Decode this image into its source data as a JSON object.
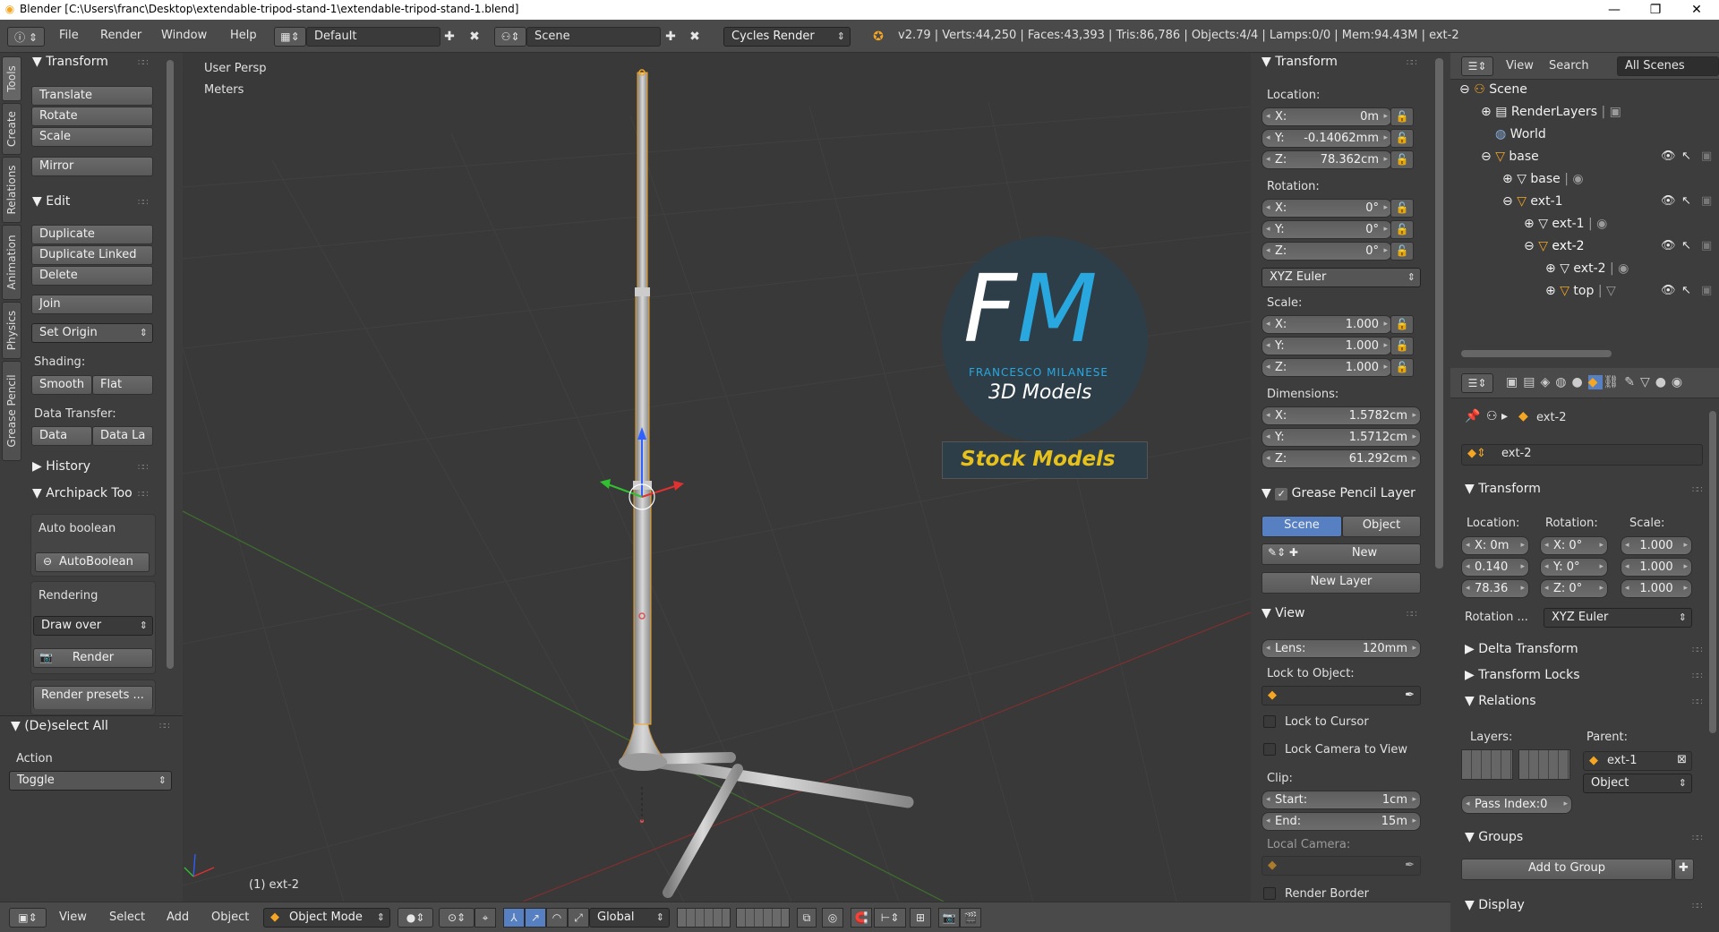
{
  "window": {
    "title": "Blender [C:\\Users\\franc\\Desktop\\extendable-tripod-stand-1\\extendable-tripod-stand-1.blend]",
    "minimize": "—",
    "maximize": "❐",
    "close": "✕"
  },
  "menubar": {
    "items": [
      "File",
      "Render",
      "Window",
      "Help"
    ],
    "layout": "Default",
    "scene": "Scene",
    "engine": "Cycles Render",
    "stats": "v2.79 | Verts:44,250 | Faces:43,393 | Tris:86,786 | Objects:4/4 | Lamps:0/0 | Mem:94.43M | ext-2"
  },
  "tabs": [
    "Tools",
    "Create",
    "Relations",
    "Animation",
    "Physics",
    "Grease Pencil"
  ],
  "toolshelf": {
    "transform_header": "Transform",
    "translate": "Translate",
    "rotate": "Rotate",
    "scale": "Scale",
    "mirror": "Mirror",
    "edit_header": "Edit",
    "duplicate": "Duplicate",
    "duplicate_linked": "Duplicate Linked",
    "delete": "Delete",
    "join": "Join",
    "set_origin": "Set Origin",
    "shading_label": "Shading:",
    "smooth": "Smooth",
    "flat": "Flat",
    "data_transfer_label": "Data Transfer:",
    "data": "Data",
    "data_la": "Data La",
    "history_header": "History",
    "archipack_header": "Archipack Too",
    "auto_boolean_label": "Auto boolean",
    "auto_boolean_btn": "AutoBoolean",
    "rendering_label": "Rendering",
    "draw_over": "Draw over",
    "render_btn": "Render",
    "render_presets": "Render presets ..."
  },
  "operator": {
    "header": "(De)select All",
    "action_label": "Action",
    "action_value": "Toggle"
  },
  "viewport": {
    "view_name": "User Persp",
    "units": "Meters",
    "object_label": "(1) ext-2",
    "watermark_initials_f": "F",
    "watermark_initials_m": "M",
    "watermark_name": "FRANCESCO MILANESE",
    "watermark_sub": "3D Models",
    "watermark_stock": "Stock Models"
  },
  "npanel": {
    "transform_header": "Transform",
    "location_label": "Location:",
    "loc_x": "0m",
    "loc_y": "-0.14062mm",
    "loc_z": "78.362cm",
    "rotation_label": "Rotation:",
    "rot_x": "0°",
    "rot_y": "0°",
    "rot_z": "0°",
    "rotation_mode": "XYZ Euler",
    "scale_label": "Scale:",
    "scale_x": "1.000",
    "scale_y": "1.000",
    "scale_z": "1.000",
    "dimensions_label": "Dimensions:",
    "dim_x": "1.5782cm",
    "dim_y": "1.5712cm",
    "dim_z": "61.292cm",
    "gp_header": "Grease Pencil Layer",
    "gp_scene": "Scene",
    "gp_object": "Object",
    "gp_new": "New",
    "gp_new_layer": "New Layer",
    "view_header": "View",
    "lens_label": "Lens:",
    "lens_value": "120mm",
    "lock_to_object": "Lock to Object:",
    "lock_to_cursor": "Lock to Cursor",
    "lock_camera": "Lock Camera to View",
    "clip_label": "Clip:",
    "clip_start_label": "Start:",
    "clip_start": "1cm",
    "clip_end_label": "End:",
    "clip_end": "15m",
    "local_camera": "Local Camera:",
    "render_border": "Render Border"
  },
  "outliner": {
    "view": "View",
    "search": "Search",
    "all_scenes": "All Scenes",
    "items": [
      {
        "label": "Scene"
      },
      {
        "label": "RenderLayers"
      },
      {
        "label": "World"
      },
      {
        "label": "base"
      },
      {
        "label": "base"
      },
      {
        "label": "ext-1"
      },
      {
        "label": "ext-1"
      },
      {
        "label": "ext-2"
      },
      {
        "label": "ext-2"
      },
      {
        "label": "top"
      }
    ]
  },
  "properties": {
    "breadcrumb": "ext-2",
    "object_name": "ext-2",
    "transform_header": "Transform",
    "location_label": "Location:",
    "rotation_label": "Rotation:",
    "scale_label": "Scale:",
    "loc_x": "X: 0m",
    "loc_y": "0.140",
    "loc_z": "78.36",
    "rot_x": "X:  0°",
    "rot_y": "Y:  0°",
    "rot_z": "Z:  0°",
    "sc_x": "1.000",
    "sc_y": "1.000",
    "sc_z": "1.000",
    "rotation_mode_label": "Rotation ...",
    "rotation_mode": "XYZ Euler",
    "delta_header": "Delta Transform",
    "locks_header": "Transform Locks",
    "relations_header": "Relations",
    "layers_label": "Layers:",
    "parent_label": "Parent:",
    "parent_value": "ext-1",
    "parent_type": "Object",
    "pass_index": "Pass Index:0",
    "groups_header": "Groups",
    "add_to_group": "Add to Group",
    "display_header": "Display"
  },
  "bottombar": {
    "view": "View",
    "select": "Select",
    "add": "Add",
    "object": "Object",
    "mode": "Object Mode",
    "orientation": "Global"
  },
  "colors": {
    "accent_blue": "#5680c2",
    "selection_orange": "#f5a623",
    "watermark_blue": "#29a8e0",
    "watermark_yellow": "#e8c21c"
  }
}
